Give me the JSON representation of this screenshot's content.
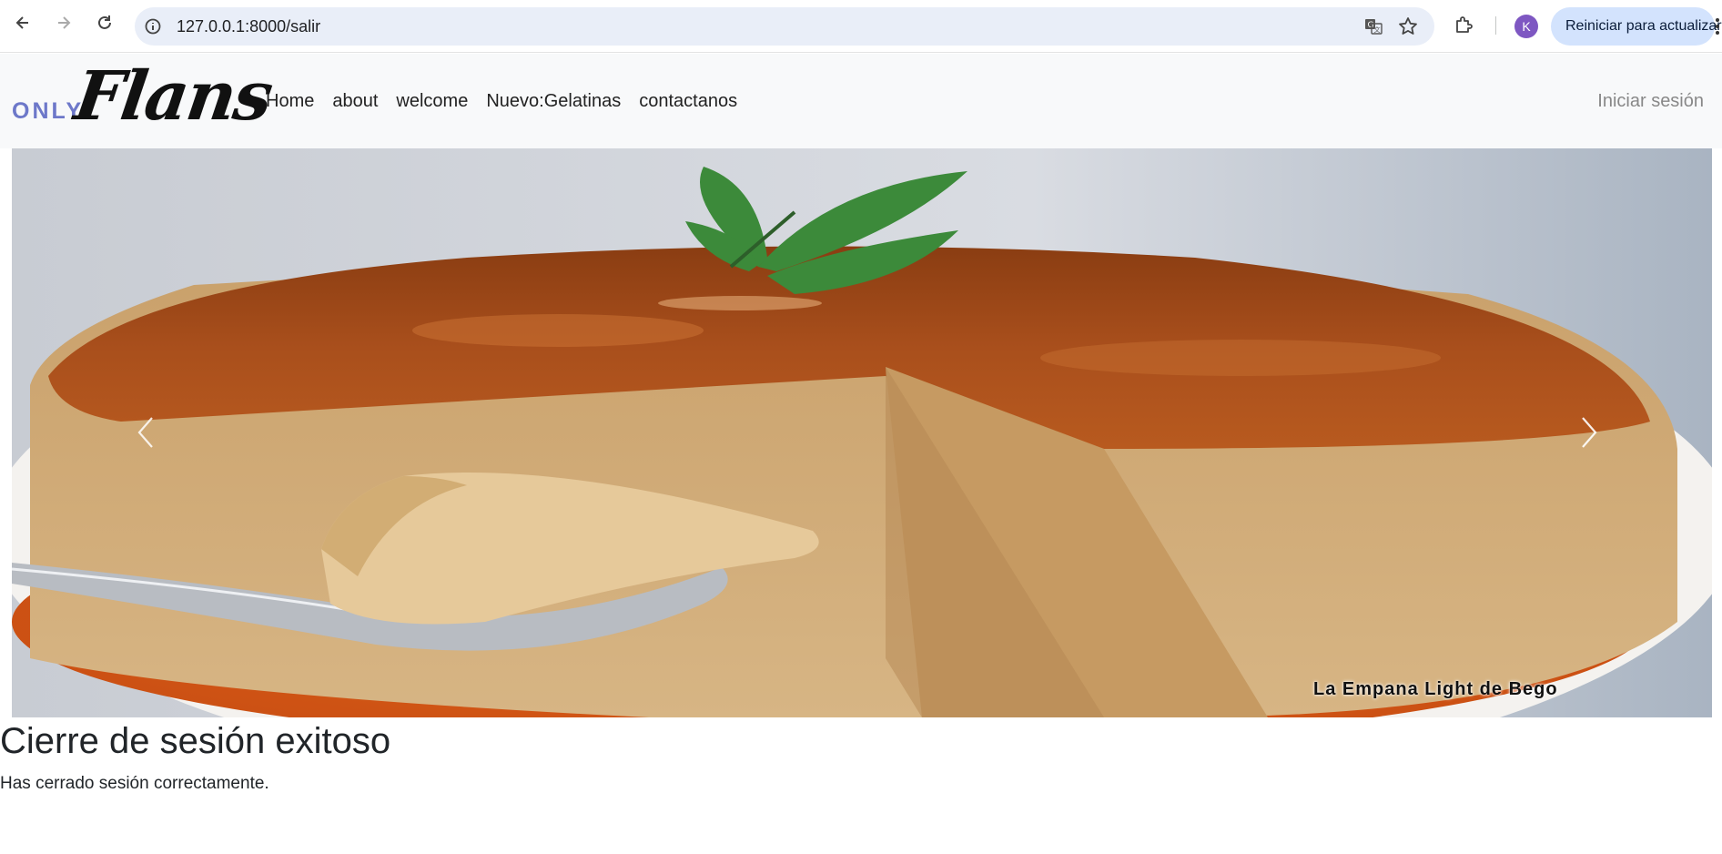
{
  "browser": {
    "url_host": "127.0.0.1",
    "url_rest": ":8000/salir",
    "profile_initial": "K",
    "update_label": "Reiniciar para actualizar",
    "icons": {
      "back": "arrow-left-icon",
      "forward": "arrow-right-icon",
      "reload": "reload-icon",
      "site_info": "site-info-icon",
      "translate": "translate-icon",
      "bookmark": "star-icon",
      "extensions": "puzzle-icon",
      "menu": "kebab-menu-icon"
    },
    "colors": {
      "omnibox": "#e9eef8",
      "profile": "#7e57c2",
      "update": "#d3e3fd"
    }
  },
  "navbar": {
    "brand_small": "ONLY",
    "brand_script": "Flans",
    "links": [
      "Home",
      "about",
      "welcome",
      "Nuevo:Gelatinas",
      "contactanos"
    ],
    "login": "Iniciar sesión",
    "colors": {
      "brand_small": "#6d78c9",
      "background": "#f8f9fa"
    }
  },
  "carousel": {
    "image_alt": "flan with caramel and mint",
    "watermark": "La Empana Light de Bego",
    "prev_icon": "chevron-left-icon",
    "next_icon": "chevron-right-icon"
  },
  "content": {
    "title": "Cierre de sesión exitoso",
    "message": "Has cerrado sesión correctamente."
  }
}
